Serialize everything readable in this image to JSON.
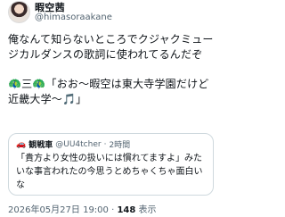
{
  "author": {
    "name": "暇空茜",
    "handle": "@himasoraakane"
  },
  "post": {
    "line1": "俺なんて知らないところでクジャクミュージカルダンスの歌詞に使われてるんだぞ",
    "emoji_prefix": "🦚三🦚",
    "line2": "「おお〜暇空は東大寺学園だけど近畿大学〜🎵」"
  },
  "quote": {
    "emoji": "🚗",
    "name": "観戦車",
    "handle": "@UU4tcher",
    "separator": "·",
    "time": "2時間",
    "text": "「貴方より女性の扱いには慣れてますよ」みたいな事言われたの今思うとめちゃくちゃ面白いな"
  },
  "footer": {
    "timestamp": "2026年05月27日 19:00",
    "dot": "·",
    "views_count": "148",
    "views_label": "表示"
  }
}
